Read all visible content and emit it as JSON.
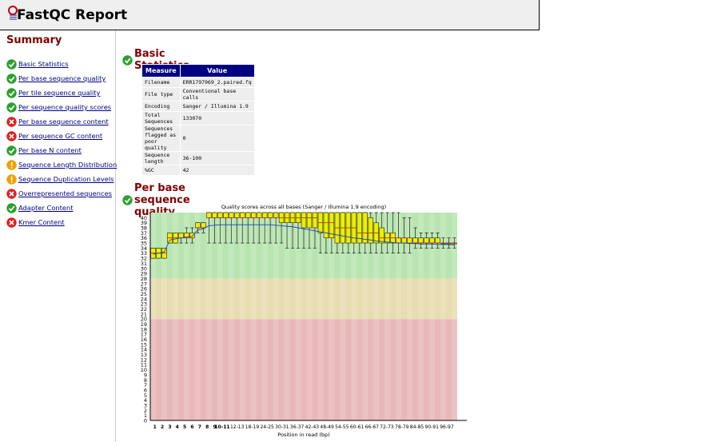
{
  "header": {
    "title": "FastQC Report"
  },
  "summary": {
    "title": "Summary",
    "items": [
      {
        "label": "Basic Statistics",
        "status": "pass"
      },
      {
        "label": "Per base sequence quality",
        "status": "pass"
      },
      {
        "label": "Per tile sequence quality",
        "status": "pass"
      },
      {
        "label": "Per sequence quality scores",
        "status": "pass"
      },
      {
        "label": "Per base sequence content",
        "status": "fail"
      },
      {
        "label": "Per sequence GC content",
        "status": "fail"
      },
      {
        "label": "Per base N content",
        "status": "pass"
      },
      {
        "label": "Sequence Length Distribution",
        "status": "warn"
      },
      {
        "label": "Sequence Duplication Levels",
        "status": "warn"
      },
      {
        "label": "Overrepresented sequences",
        "status": "fail"
      },
      {
        "label": "Adapter Content",
        "status": "pass"
      },
      {
        "label": "Kmer Content",
        "status": "fail"
      }
    ]
  },
  "basic_stats": {
    "title": "Basic Statistics",
    "headers": [
      "Measure",
      "Value"
    ],
    "rows": [
      [
        "Filename",
        "ERR1797969_2.paired.fq"
      ],
      [
        "File type",
        "Conventional base calls"
      ],
      [
        "Encoding",
        "Sanger / Illumina 1.9"
      ],
      [
        "Total Sequences",
        "133070"
      ],
      [
        "Sequences flagged as poor quality",
        "0"
      ],
      [
        "Sequence length",
        "36-100"
      ],
      [
        "%GC",
        "42"
      ]
    ]
  },
  "quality_section": {
    "title": "Per base sequence quality"
  },
  "colors": {
    "pass": "#2ca02c",
    "fail": "#e02020",
    "warn": "#f0a000",
    "heading": "#800000",
    "table_header": "#000080",
    "box": "#eeee00"
  },
  "chart_data": {
    "type": "box",
    "title": "Quality scores across all bases (Sanger / Illumina 1.9 encoding)",
    "xlabel": "Position in read (bp)",
    "ylabel": "",
    "ylim": [
      0,
      41
    ],
    "yticks": [
      0,
      1,
      2,
      3,
      4,
      5,
      6,
      7,
      8,
      9,
      10,
      11,
      12,
      13,
      14,
      15,
      16,
      17,
      18,
      19,
      20,
      21,
      22,
      23,
      24,
      25,
      26,
      27,
      28,
      29,
      30,
      31,
      32,
      33,
      34,
      35,
      36,
      37,
      38,
      39,
      40
    ],
    "background_bands": [
      {
        "from": 28,
        "to": 41,
        "color": "#b8e4b0"
      },
      {
        "from": 20,
        "to": 28,
        "color": "#e8dcb0"
      },
      {
        "from": 0,
        "to": 20,
        "color": "#e8b8b8"
      }
    ],
    "categories": [
      "1",
      "2",
      "3",
      "4",
      "5",
      "6",
      "7",
      "8",
      "9",
      "10-11",
      "12-13",
      "14-15",
      "16-17",
      "18-19",
      "20-21",
      "22-23",
      "24-25",
      "26-27",
      "28-29",
      "30-31",
      "32-33",
      "34-35",
      "36-37",
      "38-39",
      "40-41",
      "42-43",
      "44-45",
      "46-47",
      "48-49",
      "50-51",
      "52-53",
      "54-55",
      "56-57",
      "58-59",
      "60-61",
      "62-63",
      "64-65",
      "66-67",
      "68-69",
      "70-71",
      "72-73",
      "74-75",
      "76-77",
      "78-79",
      "80-81",
      "82-83",
      "84-85",
      "86-87",
      "88-89",
      "90-91",
      "92-93",
      "94-95",
      "96-97",
      "98-99",
      "100"
    ],
    "tick_labels": [
      "1",
      "2",
      "3",
      "4",
      "5",
      "6",
      "7",
      "8",
      "9",
      "10-11",
      "",
      "12-13",
      "",
      "18-19",
      "",
      "24-25",
      "",
      "30-31",
      "",
      "36-37",
      "",
      "42-43",
      "",
      "48-49",
      "",
      "54-55",
      "",
      "60-61",
      "",
      "66-67",
      "",
      "72-73",
      "",
      "78-79",
      "",
      "84-85",
      "",
      "90-91",
      "",
      "96-97",
      ""
    ],
    "series": [
      {
        "name": "box",
        "q1": [
          32,
          32,
          32,
          35,
          35,
          36,
          36,
          36,
          38,
          38,
          40,
          40,
          40,
          40,
          40,
          40,
          40,
          40,
          40,
          40,
          40,
          40,
          40,
          39,
          39,
          39,
          39,
          38,
          38,
          38,
          37,
          36,
          36,
          35,
          35,
          35,
          35,
          35,
          35,
          35,
          35,
          35,
          35,
          35,
          35,
          35,
          35,
          35,
          35,
          35,
          35,
          35,
          35,
          35,
          35
        ],
        "q3": [
          34,
          34,
          34,
          37,
          37,
          37,
          37,
          37,
          39,
          39,
          41,
          41,
          41,
          41,
          41,
          41,
          41,
          41,
          41,
          41,
          41,
          41,
          41,
          41,
          41,
          41,
          41,
          41,
          41,
          41,
          41,
          41,
          41,
          41,
          41,
          41,
          41,
          41,
          41,
          40,
          39,
          38,
          37,
          37,
          36,
          36,
          36,
          36,
          36,
          36,
          36,
          36,
          35,
          35,
          35
        ],
        "median": [
          33,
          33,
          33,
          36,
          36,
          36,
          36,
          36,
          38,
          38,
          40,
          40,
          40,
          40,
          40,
          40,
          40,
          40,
          40,
          40,
          40,
          40,
          40,
          40,
          40,
          40,
          40,
          40,
          40,
          40,
          39,
          39,
          39,
          38,
          38,
          38,
          38,
          37,
          37,
          37,
          37,
          36,
          36,
          36,
          36,
          36,
          36,
          35,
          35,
          35,
          35,
          35,
          35,
          35,
          35
        ],
        "lower": [
          32,
          32,
          32,
          35,
          35,
          35,
          35,
          35,
          37,
          37,
          35,
          35,
          35,
          35,
          35,
          35,
          35,
          35,
          35,
          35,
          35,
          35,
          35,
          35,
          34,
          34,
          34,
          34,
          34,
          34,
          33,
          33,
          33,
          33,
          33,
          33,
          33,
          33,
          33,
          33,
          33,
          33,
          33,
          33,
          33,
          33,
          33,
          34,
          34,
          34,
          34,
          34,
          34,
          34,
          34
        ],
        "upper": [
          34,
          34,
          34,
          37,
          37,
          37,
          38,
          38,
          39,
          39,
          41,
          41,
          41,
          41,
          41,
          41,
          41,
          41,
          41,
          41,
          41,
          41,
          41,
          41,
          41,
          41,
          41,
          41,
          41,
          41,
          41,
          41,
          41,
          41,
          41,
          41,
          41,
          41,
          41,
          41,
          41,
          41,
          41,
          41,
          41,
          40,
          40,
          38,
          37,
          37,
          37,
          37,
          36,
          36,
          36
        ],
        "mean": [
          32.8,
          33.0,
          33.2,
          35.6,
          35.8,
          36.0,
          36.2,
          36.3,
          37.6,
          37.8,
          38.4,
          38.5,
          38.6,
          38.6,
          38.6,
          38.6,
          38.6,
          38.6,
          38.6,
          38.6,
          38.6,
          38.6,
          38.5,
          38.4,
          38.3,
          38.2,
          38.0,
          37.8,
          37.6,
          37.4,
          37.2,
          37.0,
          36.8,
          36.6,
          36.4,
          36.2,
          36.0,
          35.9,
          35.7,
          35.6,
          35.4,
          35.3,
          35.2,
          35.1,
          35.0,
          35.0,
          34.9,
          34.9,
          34.8,
          34.8,
          34.8,
          34.7,
          34.7,
          34.7,
          34.6
        ]
      }
    ]
  }
}
